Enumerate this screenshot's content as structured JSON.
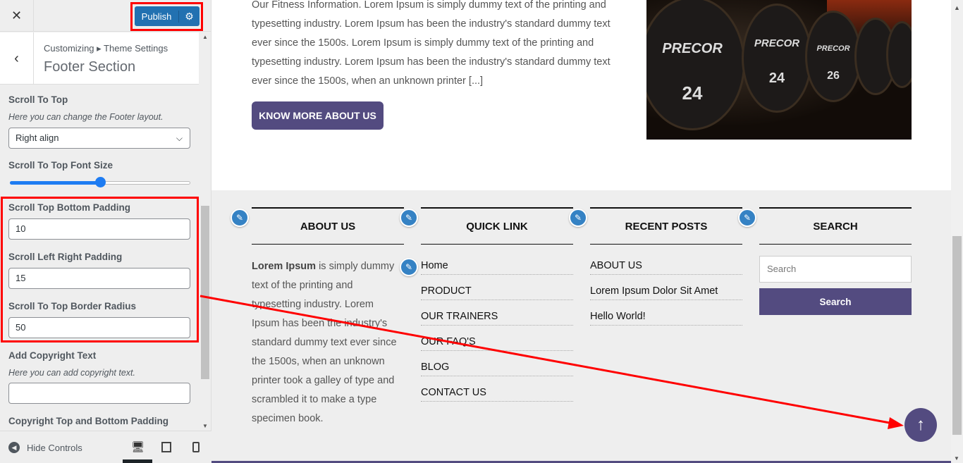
{
  "sidebar": {
    "close_icon": "close-icon",
    "publish_label": "Publish",
    "breadcrumb": "Customizing ▸ Theme Settings",
    "section_title": "Footer Section",
    "scroll_to_top": {
      "label": "Scroll To Top",
      "description": "Here you can change the Footer layout.",
      "value": "Right align"
    },
    "font_size": {
      "label": "Scroll To Top Font Size",
      "value_fraction": 0.5
    },
    "bottom_padding": {
      "label": "Scroll Top Bottom Padding",
      "value": "10"
    },
    "lr_padding": {
      "label": "Scroll Left Right Padding",
      "value": "15"
    },
    "border_radius": {
      "label": "Scroll To Top Border Radius",
      "value": "50"
    },
    "copyright": {
      "label": "Add Copyright Text",
      "description": "Here you can add copyright text.",
      "value": ""
    },
    "copyright_padding": {
      "label": "Copyright Top and Bottom Padding"
    },
    "hide_controls": "Hide Controls"
  },
  "preview": {
    "intro": "Our Fitness Information. Lorem Ipsum is simply dummy text of the printing and typesetting industry. Lorem Ipsum has been the industry's standard dummy text ever since the 1500s. Lorem Ipsum is simply dummy text of the printing and typesetting industry. Lorem Ipsum has been the industry's standard dummy text ever since the 1500s, when an unknown printer [...]",
    "know_more": "KNOW MORE ABOUT US",
    "photo_text": {
      "brand": "PRECOR",
      "nums": [
        "24",
        "24",
        "26"
      ]
    },
    "footer": {
      "about": {
        "title": "ABOUT US",
        "bold": "Lorem Ipsum",
        "text": " is simply dummy text of the printing and typesetting industry. Lorem Ipsum has been the industry's standard dummy text ever since the 1500s, when an unknown printer took a galley of type and scrambled it to make a type specimen book."
      },
      "quick": {
        "title": "QUICK LINK",
        "links": [
          "Home",
          "PRODUCT",
          "OUR TRAINERS",
          "OUR FAQ'S",
          "BLOG",
          "CONTACT US"
        ]
      },
      "recent": {
        "title": "RECENT POSTS",
        "links": [
          "ABOUT US",
          "Lorem Ipsum Dolor Sit Amet",
          "Hello World!"
        ]
      },
      "search": {
        "title": "SEARCH",
        "placeholder": "Search",
        "button": "Search"
      }
    }
  },
  "colors": {
    "accent": "#534b80",
    "publish": "#2271b1",
    "annotation": "#ff0000",
    "edit_pencil": "#3582c4"
  }
}
